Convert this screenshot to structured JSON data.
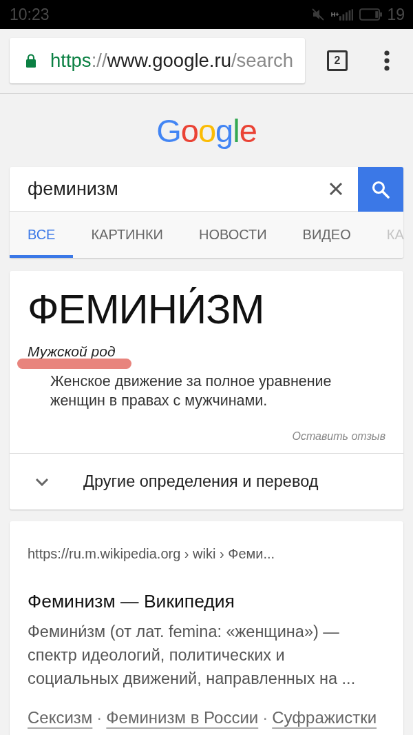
{
  "status_bar": {
    "time": "10:23",
    "network": "H+",
    "battery": "19"
  },
  "browser": {
    "url": {
      "scheme": "https",
      "separator": "://",
      "host": "www.google.ru",
      "path": "/search"
    },
    "tab_count": "2"
  },
  "logo": {
    "text": "Google"
  },
  "search": {
    "query": "феминизм"
  },
  "tabs": [
    {
      "label": "ВСЕ",
      "selected": true,
      "faded": false
    },
    {
      "label": "КАРТИНКИ",
      "selected": false,
      "faded": false
    },
    {
      "label": "НОВОСТИ",
      "selected": false,
      "faded": false
    },
    {
      "label": "ВИДЕО",
      "selected": false,
      "faded": false
    },
    {
      "label": "КА",
      "selected": false,
      "faded": true
    }
  ],
  "definition": {
    "word": "ФЕМИНИ́ЗМ",
    "gender": "Мужской род",
    "gender_marked": true,
    "meaning": "Женское движение за полное уравнение женщин в правах с мужчинами.",
    "feedback": "Оставить отзыв",
    "more": {
      "label": "Другие определения и перевод",
      "expanded": false
    }
  },
  "result": {
    "url": "https://ru.m.wikipedia.org › wiki › Феми...",
    "title": "Феминизм — Википедия",
    "snippet": "Фемини́зм (от лат. femina: «женщина») — спектр идеологий, политических и социальных движений, направленных на ...",
    "links": [
      "Сексизм",
      "Феминизм в России",
      "Суфражистки"
    ],
    "separator": "·"
  }
}
